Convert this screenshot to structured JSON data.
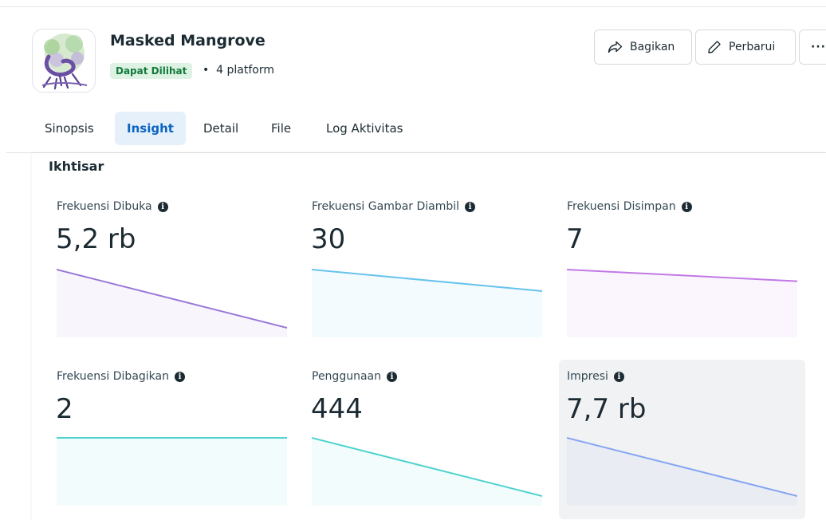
{
  "app": {
    "title": "Masked Mangrove",
    "status": "Dapat Dilihat",
    "separator": "•",
    "platforms": "4 platform"
  },
  "actions": {
    "share_label": "Bagikan",
    "update_label": "Perbarui",
    "more_label": "···"
  },
  "tabs": [
    {
      "label": "Sinopsis",
      "active": false
    },
    {
      "label": "Insight",
      "active": true
    },
    {
      "label": "Detail",
      "active": false
    },
    {
      "label": "File",
      "active": false
    },
    {
      "label": "Log Aktivitas",
      "active": false
    }
  ],
  "overview": {
    "title": "Ikhtisar",
    "metrics": [
      {
        "label": "Frekuensi Dibuka",
        "value": "5,2 rb",
        "color": "#9a78d8",
        "trend": [
          1.0,
          0.0
        ]
      },
      {
        "label": "Frekuensi Gambar Diambil",
        "value": "30",
        "color": "#66c3ec",
        "trend": [
          1.0,
          0.63
        ]
      },
      {
        "label": "Frekuensi Disimpan",
        "value": "7",
        "color": "#c179e6",
        "trend": [
          1.0,
          0.8
        ]
      },
      {
        "label": "Frekuensi Dibagikan",
        "value": "2",
        "color": "#4fd3cf",
        "trend": [
          1.0,
          1.0
        ]
      },
      {
        "label": "Penggunaan",
        "value": "444",
        "color": "#4fd3cf",
        "trend": [
          1.0,
          0.0
        ]
      },
      {
        "label": "Impresi",
        "value": "7,7 rb",
        "color": "#86a5f2",
        "trend": [
          1.0,
          0.0
        ]
      }
    ]
  },
  "icons": {
    "share": "share-arrow-icon",
    "update": "pencil-icon",
    "info": "info-icon",
    "app": "mangrove-tree-logo"
  }
}
